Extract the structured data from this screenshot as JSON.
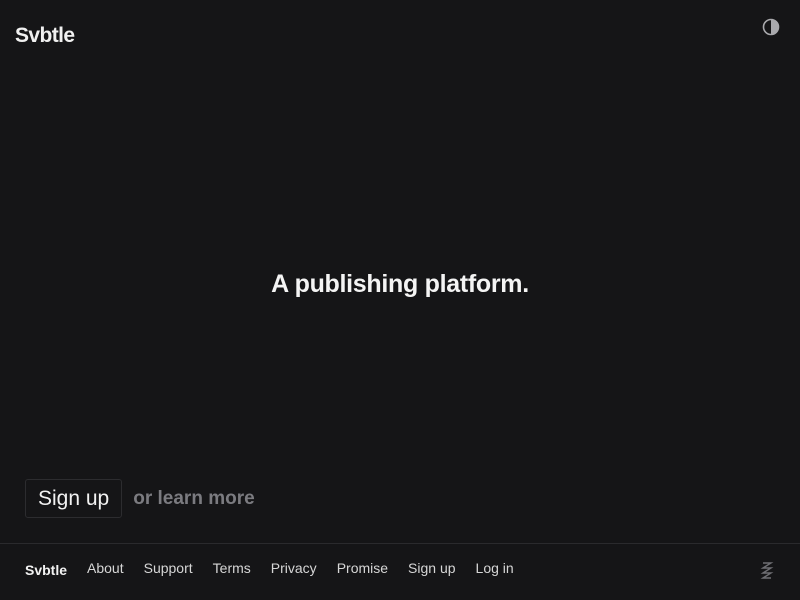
{
  "header": {
    "logo": "Svbtle",
    "theme_toggle_icon": "contrast-icon"
  },
  "hero": {
    "tagline": "A publishing platform."
  },
  "cta": {
    "signup_label": "Sign up",
    "learn_more_label": "or learn more"
  },
  "footer": {
    "brand": "Svbtle",
    "links": [
      "About",
      "Support",
      "Terms",
      "Privacy",
      "Promise",
      "Sign up",
      "Log in"
    ],
    "mark_icon": "svbtle-mark-icon"
  },
  "colors": {
    "background": "#151517",
    "text": "#f2f2f2",
    "muted": "#7b7b80",
    "border": "#2a2a2d"
  }
}
